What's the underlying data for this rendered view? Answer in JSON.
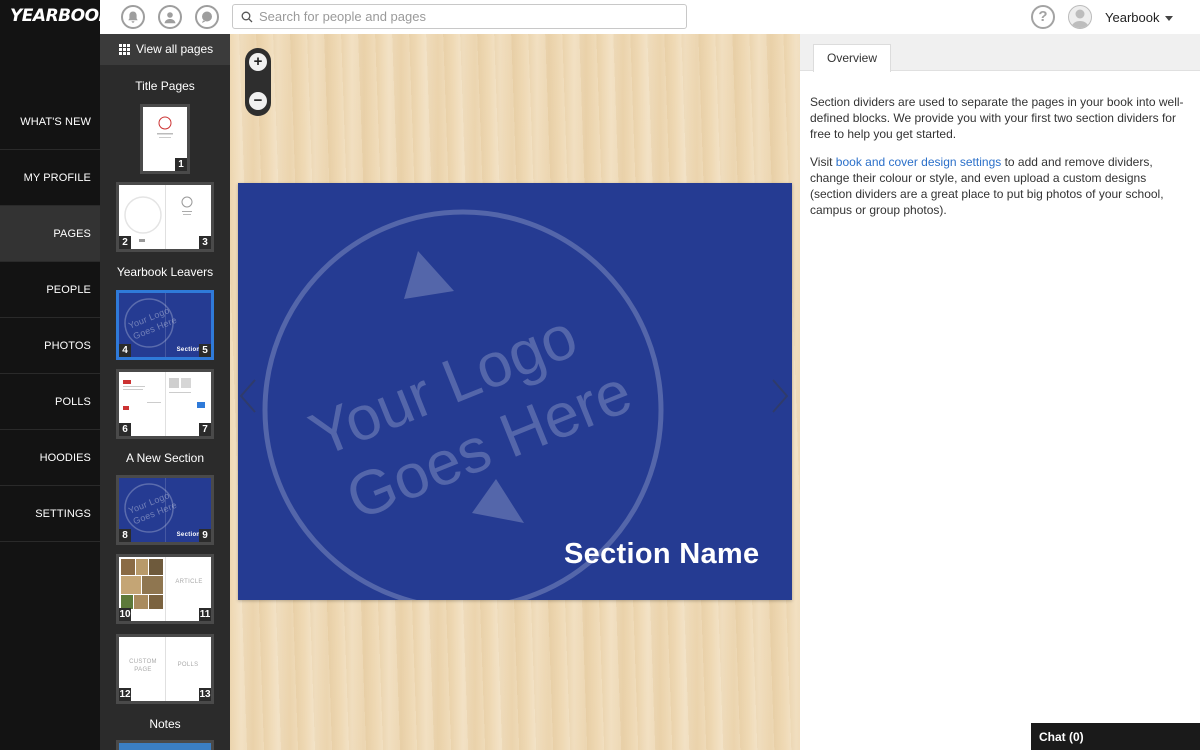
{
  "app": {
    "logo": "YEARBOOK"
  },
  "topbar": {
    "search_placeholder": "Search for people and pages",
    "help_glyph": "?",
    "user_menu_label": "Yearbook",
    "icons": [
      "bell-icon",
      "profile-icon",
      "chat-bubble-icon",
      "search-icon",
      "help-icon",
      "user-avatar-icon",
      "caret-down-icon"
    ]
  },
  "nav": {
    "items": [
      {
        "label": "WHAT'S NEW",
        "active": false
      },
      {
        "label": "MY PROFILE",
        "active": false
      },
      {
        "label": "PAGES",
        "active": true
      },
      {
        "label": "PEOPLE",
        "active": false
      },
      {
        "label": "PHOTOS",
        "active": false
      },
      {
        "label": "POLLS",
        "active": false
      },
      {
        "label": "HOODIES",
        "active": false
      },
      {
        "label": "SETTINGS",
        "active": false
      }
    ]
  },
  "thumbnails": {
    "view_all_label": "View all pages",
    "sections": [
      {
        "title": "Title Pages",
        "pages": [
          "1",
          "2",
          "3"
        ]
      },
      {
        "title": "Yearbook Leavers",
        "pages": [
          "4",
          "5",
          "6",
          "7"
        ]
      },
      {
        "title": "A New Section",
        "pages": [
          "8",
          "9",
          "10",
          "11",
          "12",
          "13"
        ]
      },
      {
        "title": "Notes",
        "pages": []
      }
    ],
    "thumb_texts": {
      "logo_small_1": "Your Logo",
      "logo_small_2": "Goes Here",
      "section_small": "Section N",
      "article": "ARTICLE",
      "custom_page_1": "CUSTOM",
      "custom_page_2": "PAGE",
      "polls": "POLLS"
    },
    "selected_spread": [
      "4",
      "5"
    ]
  },
  "canvas": {
    "zoom_in": "+",
    "zoom_out": "−",
    "logo_line_1": "Your Logo",
    "logo_line_2": "Goes Here",
    "section_name": "Section Name",
    "page_color": "#253b92",
    "background_color": "#efd9b4"
  },
  "panel": {
    "tab_label": "Overview",
    "paragraph_1": "Section dividers are used to separate the pages in your book into well-defined blocks. We provide you with your first two section dividers for free to help you get started.",
    "paragraph_2_prefix": "Visit ",
    "paragraph_2_link": "book and cover design settings",
    "paragraph_2_suffix": " to add and remove dividers, change their colour or style, and even upload a custom designs (section dividers are a great place to put big photos of your school, campus or group photos)."
  },
  "chat": {
    "label": "Chat (0)"
  },
  "colors": {
    "accent_link": "#2a6fc9",
    "nav_bg": "#131313",
    "thumb_bg": "#2b2b2b",
    "selected_border": "#2f7ad9"
  }
}
